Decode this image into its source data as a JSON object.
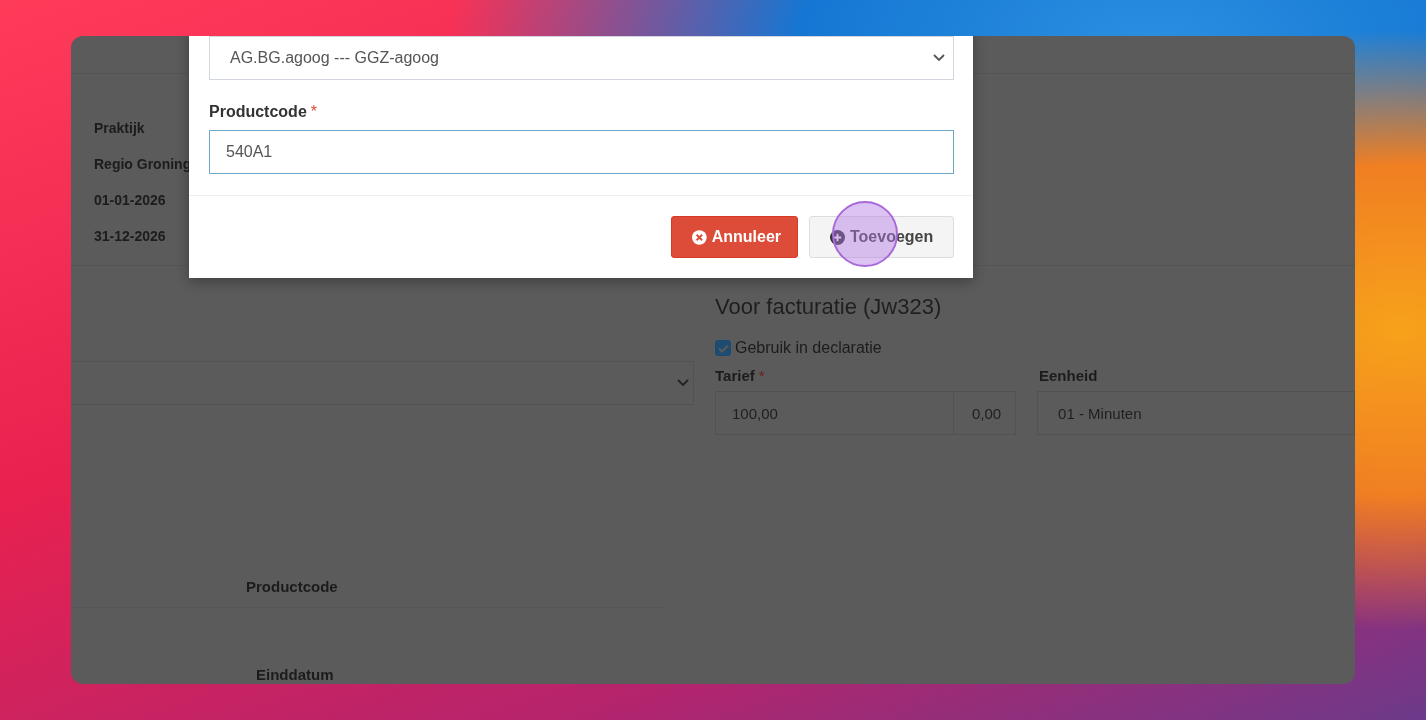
{
  "page": {
    "info": [
      "Praktijk",
      "Regio Groning",
      "01-01-2026",
      "31-12-2026"
    ],
    "billing": {
      "title": "Voor facturatie (Jw323)",
      "use_in_declaration": {
        "label": "Gebruik in declaratie",
        "checked": true
      },
      "tariff": {
        "label": "Tarief",
        "required_mark": "*",
        "value": "100,00",
        "extra": "0,00"
      },
      "unit": {
        "label": "Eenheid",
        "value": "01 - Minuten"
      }
    },
    "table": {
      "header": "Productcode",
      "next_label": "Einddatum"
    }
  },
  "modal": {
    "select_value": "AG.BG.agoog --- GGZ-agoog",
    "field": {
      "label": "Productcode",
      "required_mark": "*",
      "value": "540A1"
    },
    "buttons": [
      {
        "kind": "cancel",
        "label": "Annuleer"
      },
      {
        "kind": "add",
        "label": "Toevoegen"
      }
    ]
  }
}
